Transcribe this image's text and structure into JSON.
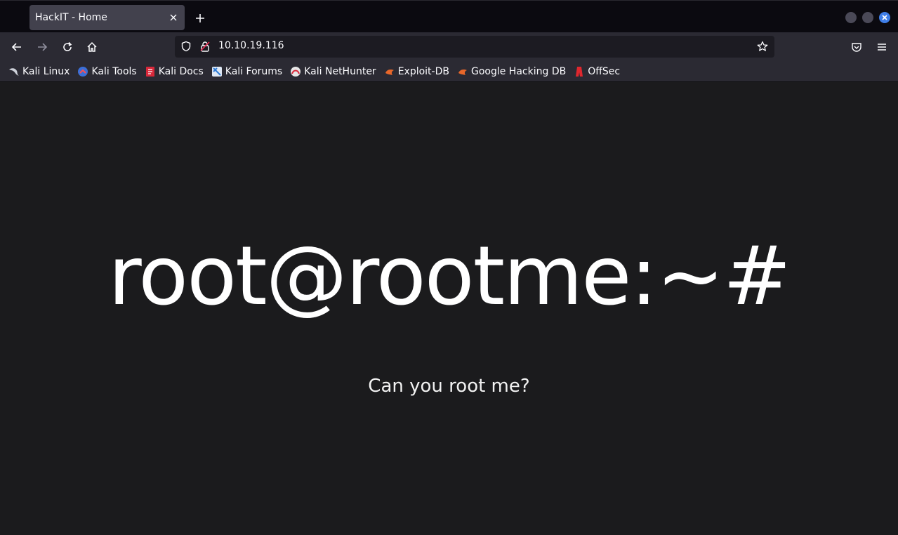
{
  "browser": {
    "tab": {
      "title": "HackIT - Home"
    },
    "url": "10.10.19.116",
    "bookmarks": [
      {
        "label": "Kali Linux",
        "icon": "kali-dragon-icon"
      },
      {
        "label": "Kali Tools",
        "icon": "kali-tools-icon"
      },
      {
        "label": "Kali Docs",
        "icon": "kali-docs-icon"
      },
      {
        "label": "Kali Forums",
        "icon": "kali-forums-icon"
      },
      {
        "label": "Kali NetHunter",
        "icon": "nethunter-icon"
      },
      {
        "label": "Exploit-DB",
        "icon": "exploit-db-icon"
      },
      {
        "label": "Google Hacking DB",
        "icon": "ghdb-icon"
      },
      {
        "label": "OffSec",
        "icon": "offsec-icon"
      }
    ]
  },
  "page": {
    "heading": "root@rootme:~#",
    "subheading": "Can you root me?"
  },
  "colors": {
    "tab_strip": "#0b0a10",
    "toolbar": "#2b2a33",
    "active_tab": "#42414d",
    "page_bg": "#1b1b1d",
    "close_button": "#3f7ee8"
  }
}
